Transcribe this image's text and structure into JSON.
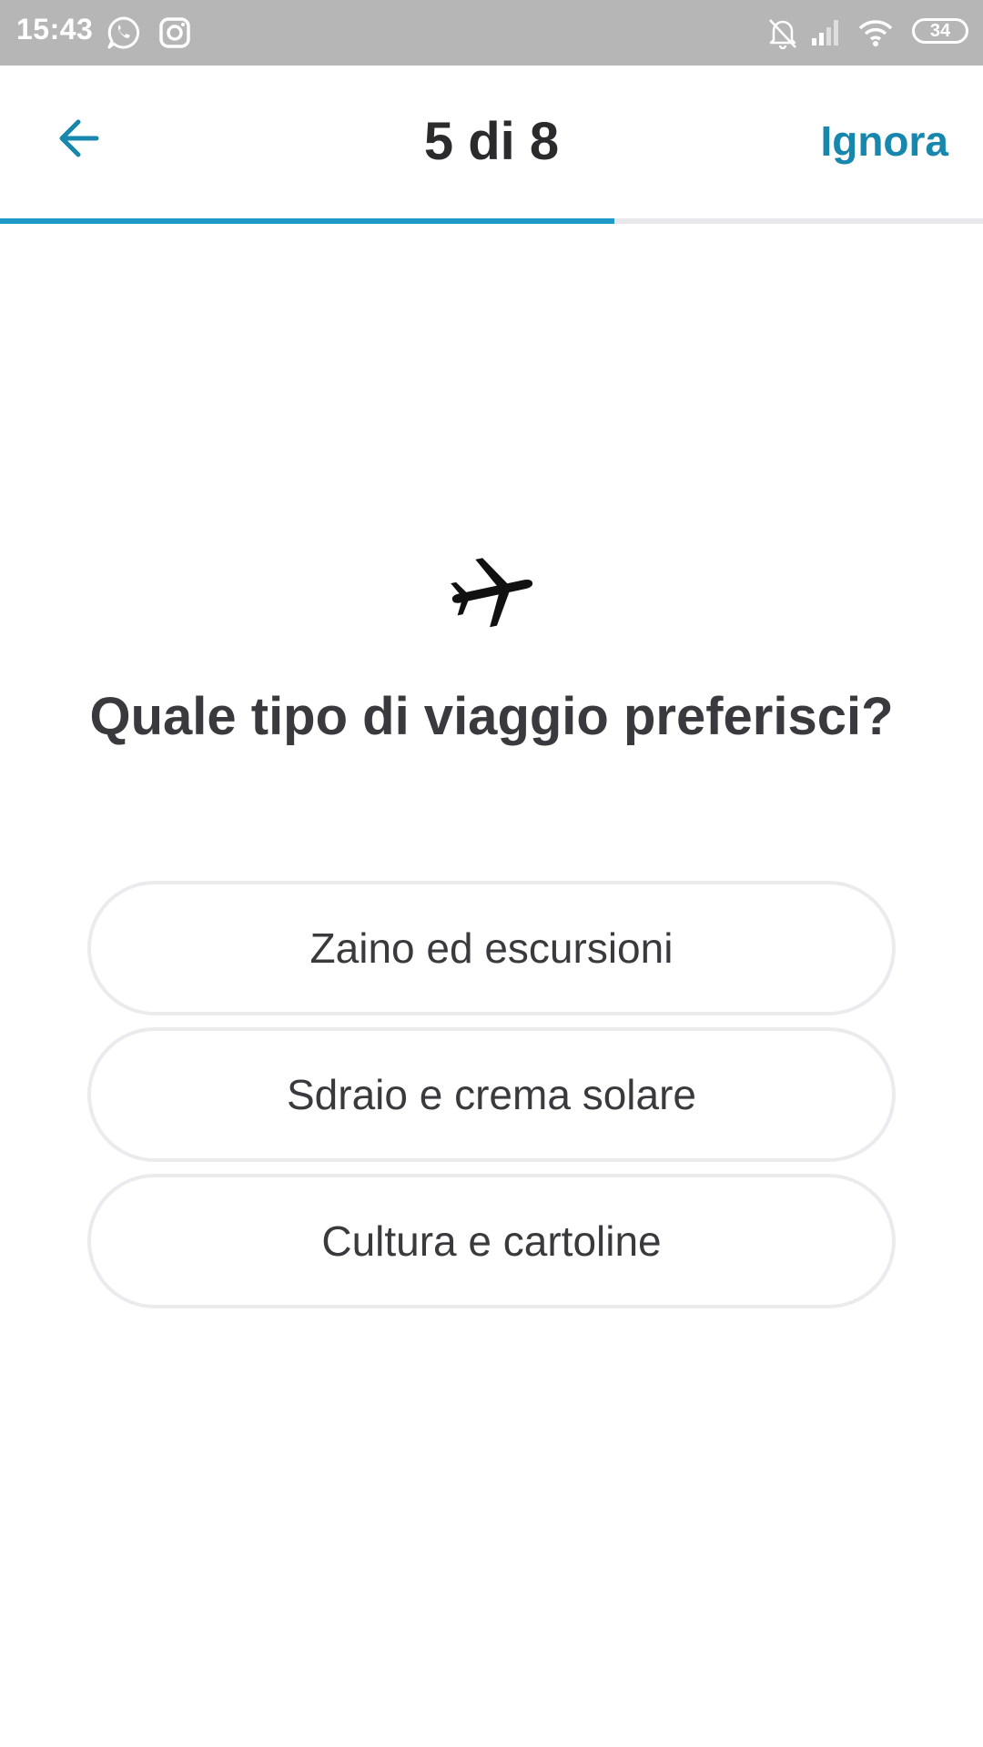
{
  "status_bar": {
    "time": "15:43",
    "battery": "34",
    "icons": [
      "whatsapp-icon",
      "instagram-icon",
      "bell-off-icon",
      "signal-icon",
      "wifi-icon",
      "battery-icon"
    ]
  },
  "header": {
    "title": "5 di 8",
    "skip_label": "Ignora",
    "back_icon": "arrow-left-icon"
  },
  "progress": {
    "current": 5,
    "total": 8,
    "fraction": 0.625
  },
  "question": {
    "icon": "airplane-icon",
    "text": "Quale tipo di viaggio preferisci?"
  },
  "options": [
    {
      "label": "Zaino ed escursioni"
    },
    {
      "label": "Sdraio e crema solare"
    },
    {
      "label": "Cultura e cartoline"
    }
  ],
  "colors": {
    "accent": "#1787ad",
    "progress": "#1f9ac6",
    "status_bar": "#b6b6b6",
    "text": "#3a3a3e",
    "border": "#ebebee"
  }
}
